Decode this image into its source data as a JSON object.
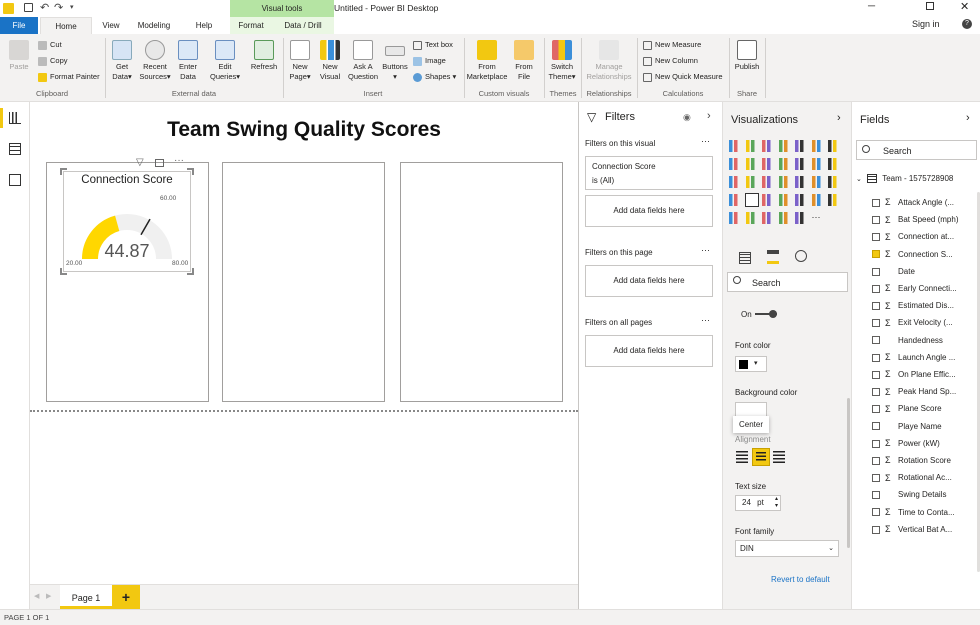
{
  "titlebar": {
    "title": "Untitled - Power BI Desktop",
    "context_group": "Visual tools",
    "sign_in": "Sign in"
  },
  "ribbon_tabs": {
    "file": "File",
    "home": "Home",
    "view": "View",
    "modeling": "Modeling",
    "help": "Help",
    "format": "Format",
    "data_drill": "Data / Drill"
  },
  "ribbon": {
    "paste": "Paste",
    "cut": "Cut",
    "copy": "Copy",
    "format_painter": "Format Painter",
    "clipboard": "Clipboard",
    "get_data": [
      "Get",
      "Data"
    ],
    "recent_sources": [
      "Recent",
      "Sources"
    ],
    "enter_data": [
      "Enter",
      "Data"
    ],
    "edit_queries": [
      "Edit",
      "Queries"
    ],
    "refresh": "Refresh",
    "external_data": "External data",
    "new_page": [
      "New",
      "Page"
    ],
    "new_visual": [
      "New",
      "Visual"
    ],
    "ask_question": [
      "Ask A",
      "Question"
    ],
    "buttons": "Buttons",
    "text_box": "Text box",
    "image": "Image",
    "shapes": "Shapes",
    "insert": "Insert",
    "from_marketplace": [
      "From",
      "Marketplace"
    ],
    "from_file": [
      "From",
      "File"
    ],
    "custom_visuals": "Custom visuals",
    "switch_theme": [
      "Switch",
      "Theme"
    ],
    "themes": "Themes",
    "manage_relationships": [
      "Manage",
      "Relationships"
    ],
    "relationships": "Relationships",
    "new_measure": "New Measure",
    "new_column": "New Column",
    "new_quick_measure": "New Quick Measure",
    "calculations": "Calculations",
    "publish": "Publish",
    "share": "Share"
  },
  "report": {
    "title": "Team Swing Quality Scores"
  },
  "gauge": {
    "title": "Connection Score",
    "value": "44.87",
    "min": "20.00",
    "max": "80.00",
    "target": "60.00",
    "value_num": 44.87,
    "min_num": 20,
    "max_num": 80,
    "target_num": 60,
    "fill_color": "#FFD700",
    "track_color": "#F0F0F0"
  },
  "pagebar": {
    "page_tab": "Page 1",
    "add": "+"
  },
  "status": {
    "text": "PAGE 1 OF 1"
  },
  "filters": {
    "header": "Filters",
    "this_visual": "Filters on this visual",
    "filter_field": "Connection Score",
    "filter_state": "is (All)",
    "add_fields": "Add data fields here",
    "this_page": "Filters on this page",
    "all_pages": "Filters on all pages"
  },
  "viz": {
    "header": "Visualizations",
    "search_placeholder": "Search",
    "toggle_label": "On",
    "font_color": "Font color",
    "background_color": "Background color",
    "tooltip": "Center",
    "alignment": "Alignment",
    "text_size": "Text size",
    "text_size_value": "24",
    "text_size_unit": "pt",
    "font_family": "Font family",
    "font_family_value": "DIN",
    "revert": "Revert to default"
  },
  "fields": {
    "header": "Fields",
    "search_placeholder": "Search",
    "table": "Team - 1575728908",
    "items": [
      {
        "name": "Attack Angle (...",
        "sigma": true,
        "checked": false
      },
      {
        "name": "Bat Speed (mph)",
        "sigma": true,
        "checked": false
      },
      {
        "name": "Connection at...",
        "sigma": true,
        "checked": false
      },
      {
        "name": "Connection S...",
        "sigma": true,
        "checked": true
      },
      {
        "name": "Date",
        "sigma": false,
        "checked": false
      },
      {
        "name": "Early Connecti...",
        "sigma": true,
        "checked": false
      },
      {
        "name": "Estimated Dis...",
        "sigma": true,
        "checked": false
      },
      {
        "name": "Exit Velocity (...",
        "sigma": true,
        "checked": false
      },
      {
        "name": "Handedness",
        "sigma": false,
        "checked": false
      },
      {
        "name": "Launch Angle ...",
        "sigma": true,
        "checked": false
      },
      {
        "name": "On Plane Effic...",
        "sigma": true,
        "checked": false
      },
      {
        "name": "Peak Hand Sp...",
        "sigma": true,
        "checked": false
      },
      {
        "name": "Plane Score",
        "sigma": true,
        "checked": false
      },
      {
        "name": "Playe Name",
        "sigma": false,
        "checked": false
      },
      {
        "name": "Power (kW)",
        "sigma": true,
        "checked": false
      },
      {
        "name": "Rotation Score",
        "sigma": true,
        "checked": false
      },
      {
        "name": "Rotational Ac...",
        "sigma": true,
        "checked": false
      },
      {
        "name": "Swing Details",
        "sigma": false,
        "checked": false
      },
      {
        "name": "Time to Conta...",
        "sigma": true,
        "checked": false
      },
      {
        "name": "Vertical Bat A...",
        "sigma": true,
        "checked": false
      }
    ]
  }
}
